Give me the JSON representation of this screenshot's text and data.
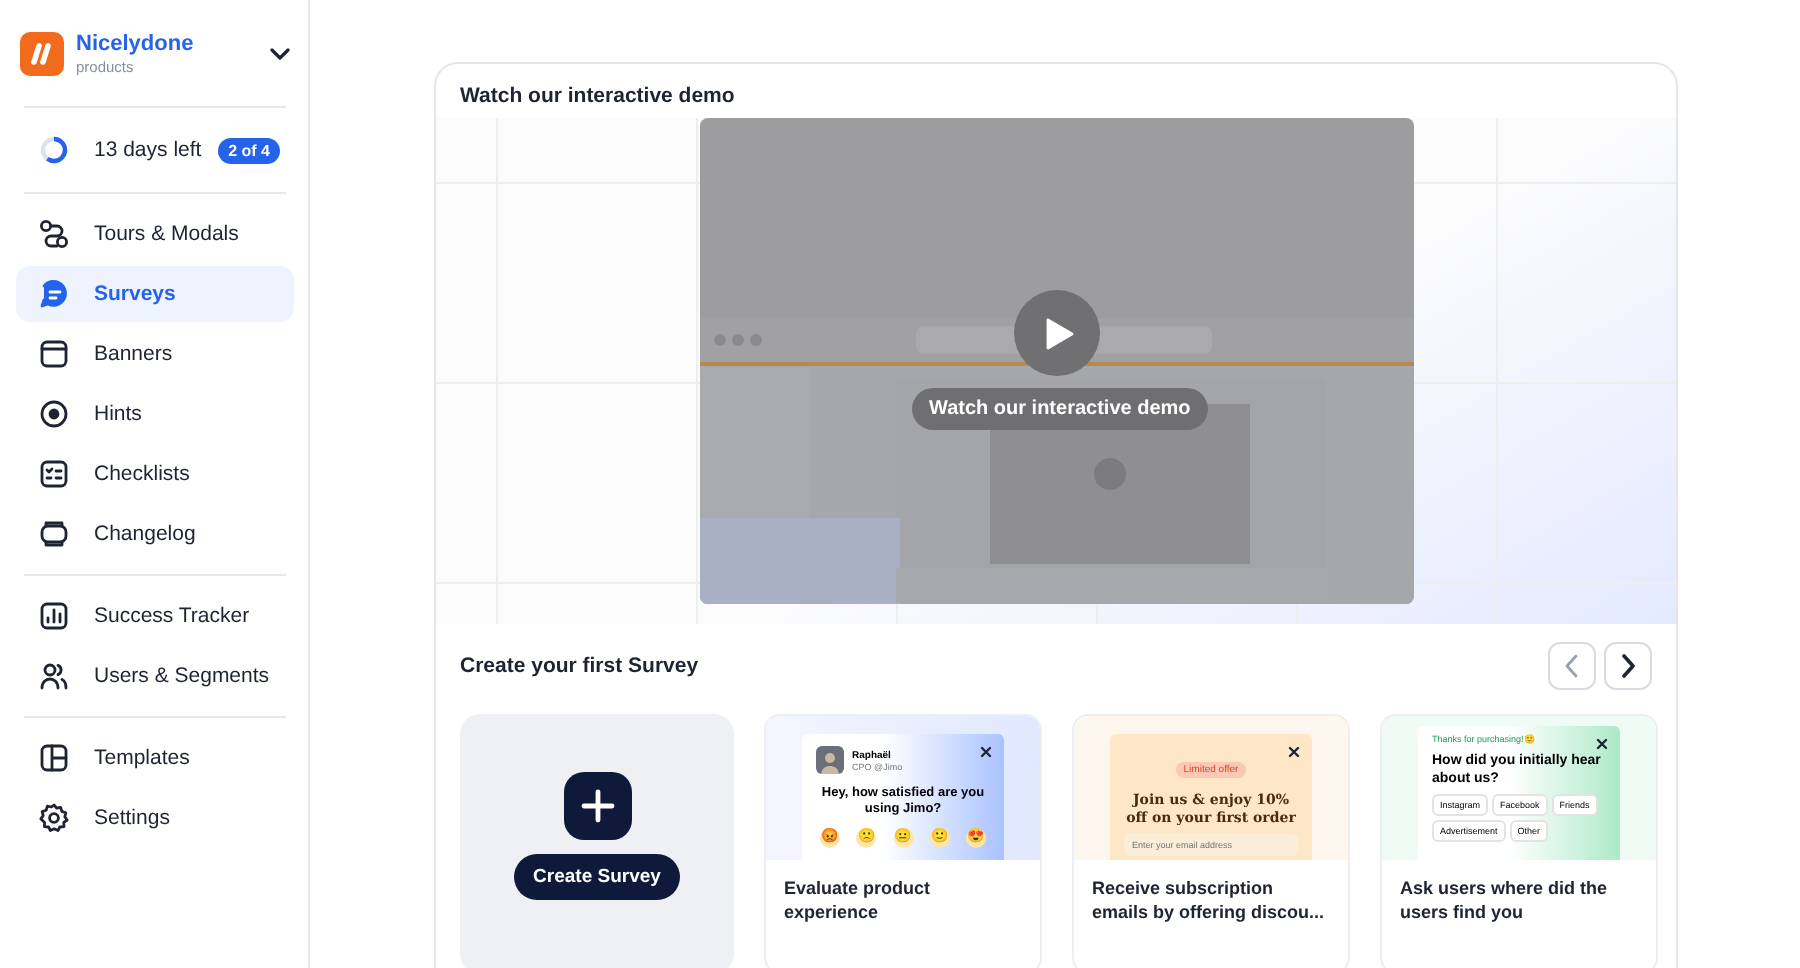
{
  "workspace": {
    "name": "Nicelydone",
    "subtitle": "products"
  },
  "trial": {
    "label": "13 days left",
    "level": 0.6,
    "badge": "2 of 4"
  },
  "nav_groups": [
    [
      {
        "label": "Tours & Modals",
        "selected": false
      },
      {
        "label": "Surveys",
        "selected": true
      },
      {
        "label": "Banners",
        "selected": false
      },
      {
        "label": "Hints",
        "selected": false
      },
      {
        "label": "Checklists",
        "selected": false
      },
      {
        "label": "Changelog",
        "selected": false
      }
    ],
    [
      {
        "label": "Success Tracker",
        "selected": false
      },
      {
        "label": "Users & Segments",
        "selected": false
      }
    ],
    [
      {
        "label": "Templates",
        "selected": false
      },
      {
        "label": "Settings",
        "selected": false
      }
    ]
  ],
  "demo": {
    "title": "Watch our interactive demo",
    "video": {
      "kind": "picture",
      "caption": "Watch our interactive demo"
    }
  },
  "templates_section": {
    "title": "Create your first Survey",
    "create_label": "Create Survey",
    "templates": [
      {
        "kind": "nps",
        "title": "Evaluate product experience",
        "preview": {
          "name": "Raphaël",
          "role": "CPO @Jimo",
          "question": "Hey, how satisfied are you using Jimo?",
          "emojis": [
            "😡",
            "🙁",
            "😐",
            "🙂",
            "😍"
          ]
        }
      },
      {
        "kind": "offer",
        "title": "Receive subscription emails by offering discou...",
        "preview": {
          "tag": "Limited offer",
          "headline": "Join us & enjoy 10% off on your first order",
          "placeholder": "Enter your email address"
        }
      },
      {
        "kind": "choice",
        "title": "Ask users where did the users find you",
        "preview": {
          "note": "Thanks for purchasing!🙂",
          "question": "How did you initially hear about us?",
          "options": [
            "Instagram",
            "Facebook",
            "Friends",
            "Advertisement",
            "Other"
          ]
        }
      }
    ]
  }
}
